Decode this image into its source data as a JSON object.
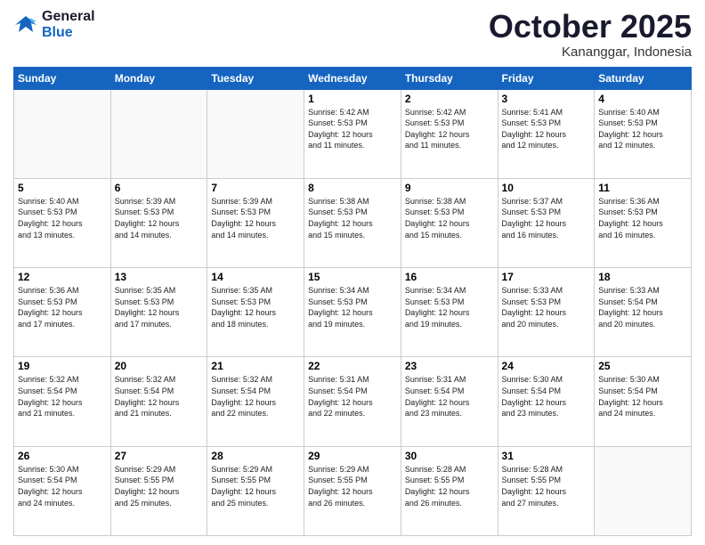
{
  "header": {
    "logo_line1": "General",
    "logo_line2": "Blue",
    "month_title": "October 2025",
    "location": "Kananggar, Indonesia"
  },
  "weekdays": [
    "Sunday",
    "Monday",
    "Tuesday",
    "Wednesday",
    "Thursday",
    "Friday",
    "Saturday"
  ],
  "weeks": [
    [
      {
        "day": "",
        "text": ""
      },
      {
        "day": "",
        "text": ""
      },
      {
        "day": "",
        "text": ""
      },
      {
        "day": "1",
        "text": "Sunrise: 5:42 AM\nSunset: 5:53 PM\nDaylight: 12 hours\nand 11 minutes."
      },
      {
        "day": "2",
        "text": "Sunrise: 5:42 AM\nSunset: 5:53 PM\nDaylight: 12 hours\nand 11 minutes."
      },
      {
        "day": "3",
        "text": "Sunrise: 5:41 AM\nSunset: 5:53 PM\nDaylight: 12 hours\nand 12 minutes."
      },
      {
        "day": "4",
        "text": "Sunrise: 5:40 AM\nSunset: 5:53 PM\nDaylight: 12 hours\nand 12 minutes."
      }
    ],
    [
      {
        "day": "5",
        "text": "Sunrise: 5:40 AM\nSunset: 5:53 PM\nDaylight: 12 hours\nand 13 minutes."
      },
      {
        "day": "6",
        "text": "Sunrise: 5:39 AM\nSunset: 5:53 PM\nDaylight: 12 hours\nand 14 minutes."
      },
      {
        "day": "7",
        "text": "Sunrise: 5:39 AM\nSunset: 5:53 PM\nDaylight: 12 hours\nand 14 minutes."
      },
      {
        "day": "8",
        "text": "Sunrise: 5:38 AM\nSunset: 5:53 PM\nDaylight: 12 hours\nand 15 minutes."
      },
      {
        "day": "9",
        "text": "Sunrise: 5:38 AM\nSunset: 5:53 PM\nDaylight: 12 hours\nand 15 minutes."
      },
      {
        "day": "10",
        "text": "Sunrise: 5:37 AM\nSunset: 5:53 PM\nDaylight: 12 hours\nand 16 minutes."
      },
      {
        "day": "11",
        "text": "Sunrise: 5:36 AM\nSunset: 5:53 PM\nDaylight: 12 hours\nand 16 minutes."
      }
    ],
    [
      {
        "day": "12",
        "text": "Sunrise: 5:36 AM\nSunset: 5:53 PM\nDaylight: 12 hours\nand 17 minutes."
      },
      {
        "day": "13",
        "text": "Sunrise: 5:35 AM\nSunset: 5:53 PM\nDaylight: 12 hours\nand 17 minutes."
      },
      {
        "day": "14",
        "text": "Sunrise: 5:35 AM\nSunset: 5:53 PM\nDaylight: 12 hours\nand 18 minutes."
      },
      {
        "day": "15",
        "text": "Sunrise: 5:34 AM\nSunset: 5:53 PM\nDaylight: 12 hours\nand 19 minutes."
      },
      {
        "day": "16",
        "text": "Sunrise: 5:34 AM\nSunset: 5:53 PM\nDaylight: 12 hours\nand 19 minutes."
      },
      {
        "day": "17",
        "text": "Sunrise: 5:33 AM\nSunset: 5:53 PM\nDaylight: 12 hours\nand 20 minutes."
      },
      {
        "day": "18",
        "text": "Sunrise: 5:33 AM\nSunset: 5:54 PM\nDaylight: 12 hours\nand 20 minutes."
      }
    ],
    [
      {
        "day": "19",
        "text": "Sunrise: 5:32 AM\nSunset: 5:54 PM\nDaylight: 12 hours\nand 21 minutes."
      },
      {
        "day": "20",
        "text": "Sunrise: 5:32 AM\nSunset: 5:54 PM\nDaylight: 12 hours\nand 21 minutes."
      },
      {
        "day": "21",
        "text": "Sunrise: 5:32 AM\nSunset: 5:54 PM\nDaylight: 12 hours\nand 22 minutes."
      },
      {
        "day": "22",
        "text": "Sunrise: 5:31 AM\nSunset: 5:54 PM\nDaylight: 12 hours\nand 22 minutes."
      },
      {
        "day": "23",
        "text": "Sunrise: 5:31 AM\nSunset: 5:54 PM\nDaylight: 12 hours\nand 23 minutes."
      },
      {
        "day": "24",
        "text": "Sunrise: 5:30 AM\nSunset: 5:54 PM\nDaylight: 12 hours\nand 23 minutes."
      },
      {
        "day": "25",
        "text": "Sunrise: 5:30 AM\nSunset: 5:54 PM\nDaylight: 12 hours\nand 24 minutes."
      }
    ],
    [
      {
        "day": "26",
        "text": "Sunrise: 5:30 AM\nSunset: 5:54 PM\nDaylight: 12 hours\nand 24 minutes."
      },
      {
        "day": "27",
        "text": "Sunrise: 5:29 AM\nSunset: 5:55 PM\nDaylight: 12 hours\nand 25 minutes."
      },
      {
        "day": "28",
        "text": "Sunrise: 5:29 AM\nSunset: 5:55 PM\nDaylight: 12 hours\nand 25 minutes."
      },
      {
        "day": "29",
        "text": "Sunrise: 5:29 AM\nSunset: 5:55 PM\nDaylight: 12 hours\nand 26 minutes."
      },
      {
        "day": "30",
        "text": "Sunrise: 5:28 AM\nSunset: 5:55 PM\nDaylight: 12 hours\nand 26 minutes."
      },
      {
        "day": "31",
        "text": "Sunrise: 5:28 AM\nSunset: 5:55 PM\nDaylight: 12 hours\nand 27 minutes."
      },
      {
        "day": "",
        "text": ""
      }
    ]
  ]
}
